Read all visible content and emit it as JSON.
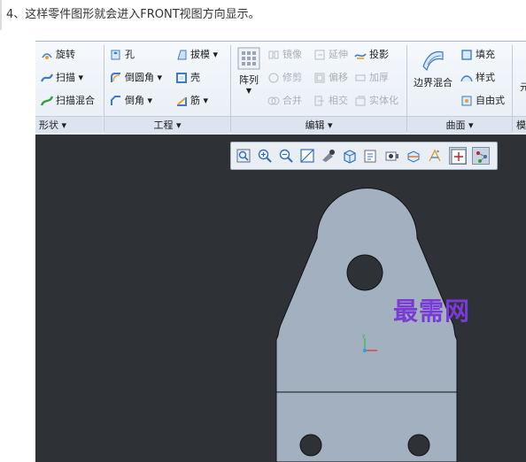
{
  "caption": "4、这样零件图形就会进入FRONT视图方向显示。",
  "ribbon": {
    "shape": {
      "revolve": "旋转",
      "sweep": "扫描 ▾",
      "swept_blend": "扫描混合",
      "label": "形状 ▾"
    },
    "engineering": {
      "hole": "孔",
      "draft": "拔模 ▾",
      "round": "倒圆角 ▾",
      "shell": "壳",
      "chamfer": "倒角 ▾",
      "rib": "筋 ▾",
      "label": "工程 ▾"
    },
    "editing": {
      "pattern": "阵列",
      "mirror": "镜像",
      "extend": "延伸",
      "project": "投影",
      "trim": "修剪",
      "offset": "偏移",
      "thicken": "加厚",
      "merge": "合并",
      "intersect": "相交",
      "solidify": "实体化",
      "label": "编辑 ▾"
    },
    "surfaces": {
      "boundary_blend": "边界混合",
      "fill": "填充",
      "style": "样式",
      "freestyle": "自由式",
      "label": "曲面 ▾"
    },
    "cut_off": {
      "top": "元",
      "label": "模"
    }
  },
  "view_toolbar": {
    "buttons": [
      "refit-icon",
      "zoom-in-icon",
      "zoom-out-icon",
      "repaint-icon",
      "display-style-icon",
      "saved-orientations-icon",
      "view-manager-icon",
      "perspective-icon",
      "section-icon",
      "datum-display-icon",
      "spin-center-icon",
      "annotation-display-icon"
    ],
    "active": [
      "spin-center-icon",
      "annotation-display-icon"
    ]
  },
  "colors": {
    "viewport_bg": "#2e3236",
    "part_fill": "#a3b0c0",
    "part_edge": "#101214",
    "csys_x": "#e03030",
    "csys_y": "#30c040",
    "csys_z": "#30a0e0"
  },
  "watermark": "最需网"
}
